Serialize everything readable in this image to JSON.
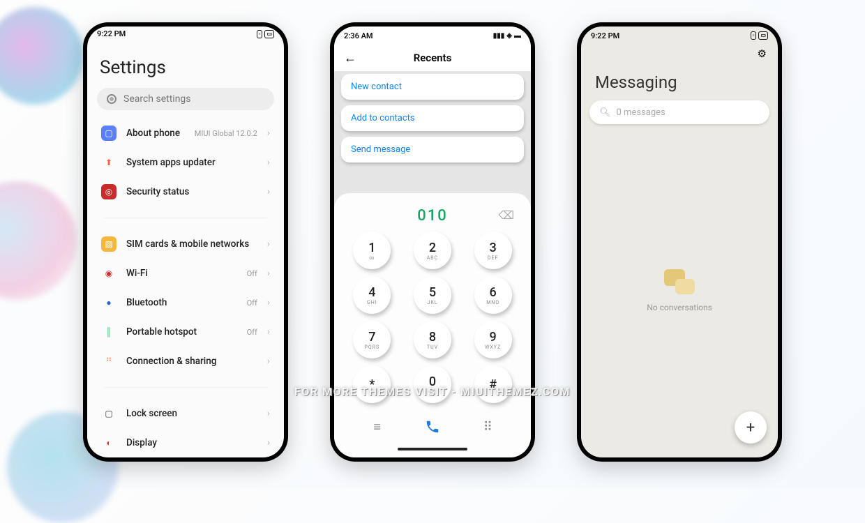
{
  "watermark": "FOR MORE THEMES VISIT - MIUITHEMEZ.COM",
  "phone1": {
    "time": "9:22 PM",
    "title": "Settings",
    "search_placeholder": "Search settings",
    "items": [
      {
        "label": "About phone",
        "meta": "MIUI Global 12.0.2",
        "icon_bg": "#5b7fff",
        "icon_glyph": "▢"
      },
      {
        "label": "System apps updater",
        "meta": "",
        "icon_bg": "#fff",
        "icon_glyph": "↑",
        "icon_color": "#ff5a3c"
      },
      {
        "label": "Security status",
        "meta": "",
        "icon_bg": "#c92b2b",
        "icon_glyph": "◎"
      }
    ],
    "items2": [
      {
        "label": "SIM cards & mobile networks",
        "meta": "",
        "icon_bg": "#f6b73c",
        "icon_glyph": "▧"
      },
      {
        "label": "Wi-Fi",
        "meta": "Off",
        "icon_bg": "#fff",
        "icon_glyph": "◉",
        "icon_color": "#c4302b"
      },
      {
        "label": "Bluetooth",
        "meta": "Off",
        "icon_bg": "#fff",
        "icon_glyph": "●",
        "icon_color": "#2b63c4"
      },
      {
        "label": "Portable hotspot",
        "meta": "Off",
        "icon_bg": "#fff",
        "icon_glyph": "║",
        "icon_color": "#3bbf72"
      },
      {
        "label": "Connection & sharing",
        "meta": "",
        "icon_bg": "#fff",
        "icon_glyph": "⠛",
        "icon_color": "#ff7b3c"
      }
    ],
    "items3": [
      {
        "label": "Lock screen",
        "meta": "",
        "icon_bg": "#fff",
        "icon_glyph": "▢",
        "icon_color": "#333"
      },
      {
        "label": "Display",
        "meta": "",
        "icon_bg": "#fff",
        "icon_glyph": "◐",
        "icon_color": "#d23b3b"
      }
    ]
  },
  "phone2": {
    "time": "2:36 AM",
    "header": "Recents",
    "actions": [
      "New contact",
      "Add to contacts",
      "Send message"
    ],
    "typed": "010",
    "keys": [
      {
        "n": "1",
        "s": "∞"
      },
      {
        "n": "2",
        "s": "ABC"
      },
      {
        "n": "3",
        "s": "DEF"
      },
      {
        "n": "4",
        "s": "GHI"
      },
      {
        "n": "5",
        "s": "JKL"
      },
      {
        "n": "6",
        "s": "MNO"
      },
      {
        "n": "7",
        "s": "PQRS"
      },
      {
        "n": "8",
        "s": "TUV"
      },
      {
        "n": "9",
        "s": "WXYZ"
      },
      {
        "n": "*",
        "s": ""
      },
      {
        "n": "0",
        "s": "+"
      },
      {
        "n": "#",
        "s": ""
      }
    ]
  },
  "phone3": {
    "time": "9:22 PM",
    "title": "Messaging",
    "search_placeholder": "0 messages",
    "empty_text": "No conversations"
  }
}
